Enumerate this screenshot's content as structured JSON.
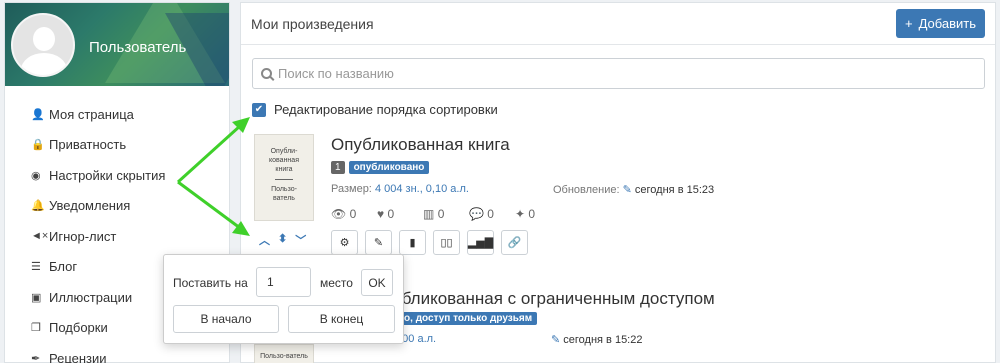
{
  "sidebar": {
    "user_name": "Пользователь",
    "items": [
      {
        "label": "Моя страница",
        "icon": "user-icon"
      },
      {
        "label": "Приватность",
        "icon": "lock-icon"
      },
      {
        "label": "Настройки скрытия",
        "icon": "eye-slash-icon"
      },
      {
        "label": "Уведомления",
        "icon": "bell-icon"
      },
      {
        "label": "Игнор-лист",
        "icon": "mute-icon"
      },
      {
        "label": "Блог",
        "icon": "blog-icon"
      },
      {
        "label": "Иллюстрации",
        "icon": "image-icon"
      },
      {
        "label": "Подборки",
        "icon": "collection-icon"
      },
      {
        "label": "Рецензии",
        "icon": "quill-icon"
      }
    ]
  },
  "header": {
    "title": "Мои произведения",
    "add_label": "Добавить"
  },
  "search": {
    "placeholder": "Поиск по названию"
  },
  "sort_edit": {
    "label": "Редактирование порядка сортировки",
    "checked": true
  },
  "book1": {
    "cover_title": "Опубли-кованная книга",
    "cover_author": "Пользо-ватель",
    "title": "Опубликованная книга",
    "position": "1",
    "status": "опубликовано",
    "size_label": "Размер:",
    "size_value": "4 004 зн., 0,10 а.л.",
    "update_label": "Обновление:",
    "update_value": "сегодня в 15:23",
    "stats": {
      "views": "0",
      "likes": "0",
      "library": "0",
      "comments": "0",
      "awards": "0"
    }
  },
  "book2": {
    "cover_author": "Пользо-ватель",
    "title_visible": "убликованная с ограниченным доступом",
    "status_visible": "но, доступ только друзьям",
    "size_visible": "0,00 а.л.",
    "update_visible": "сегодня в 15:22"
  },
  "popover": {
    "put_label": "Поставить на",
    "position_value": "1",
    "place_label": "место",
    "ok_label": "OK",
    "to_start_label": "В начало",
    "to_end_label": "В конец"
  },
  "colors": {
    "accent": "#3c78b4",
    "arrow": "#3fd02a"
  }
}
